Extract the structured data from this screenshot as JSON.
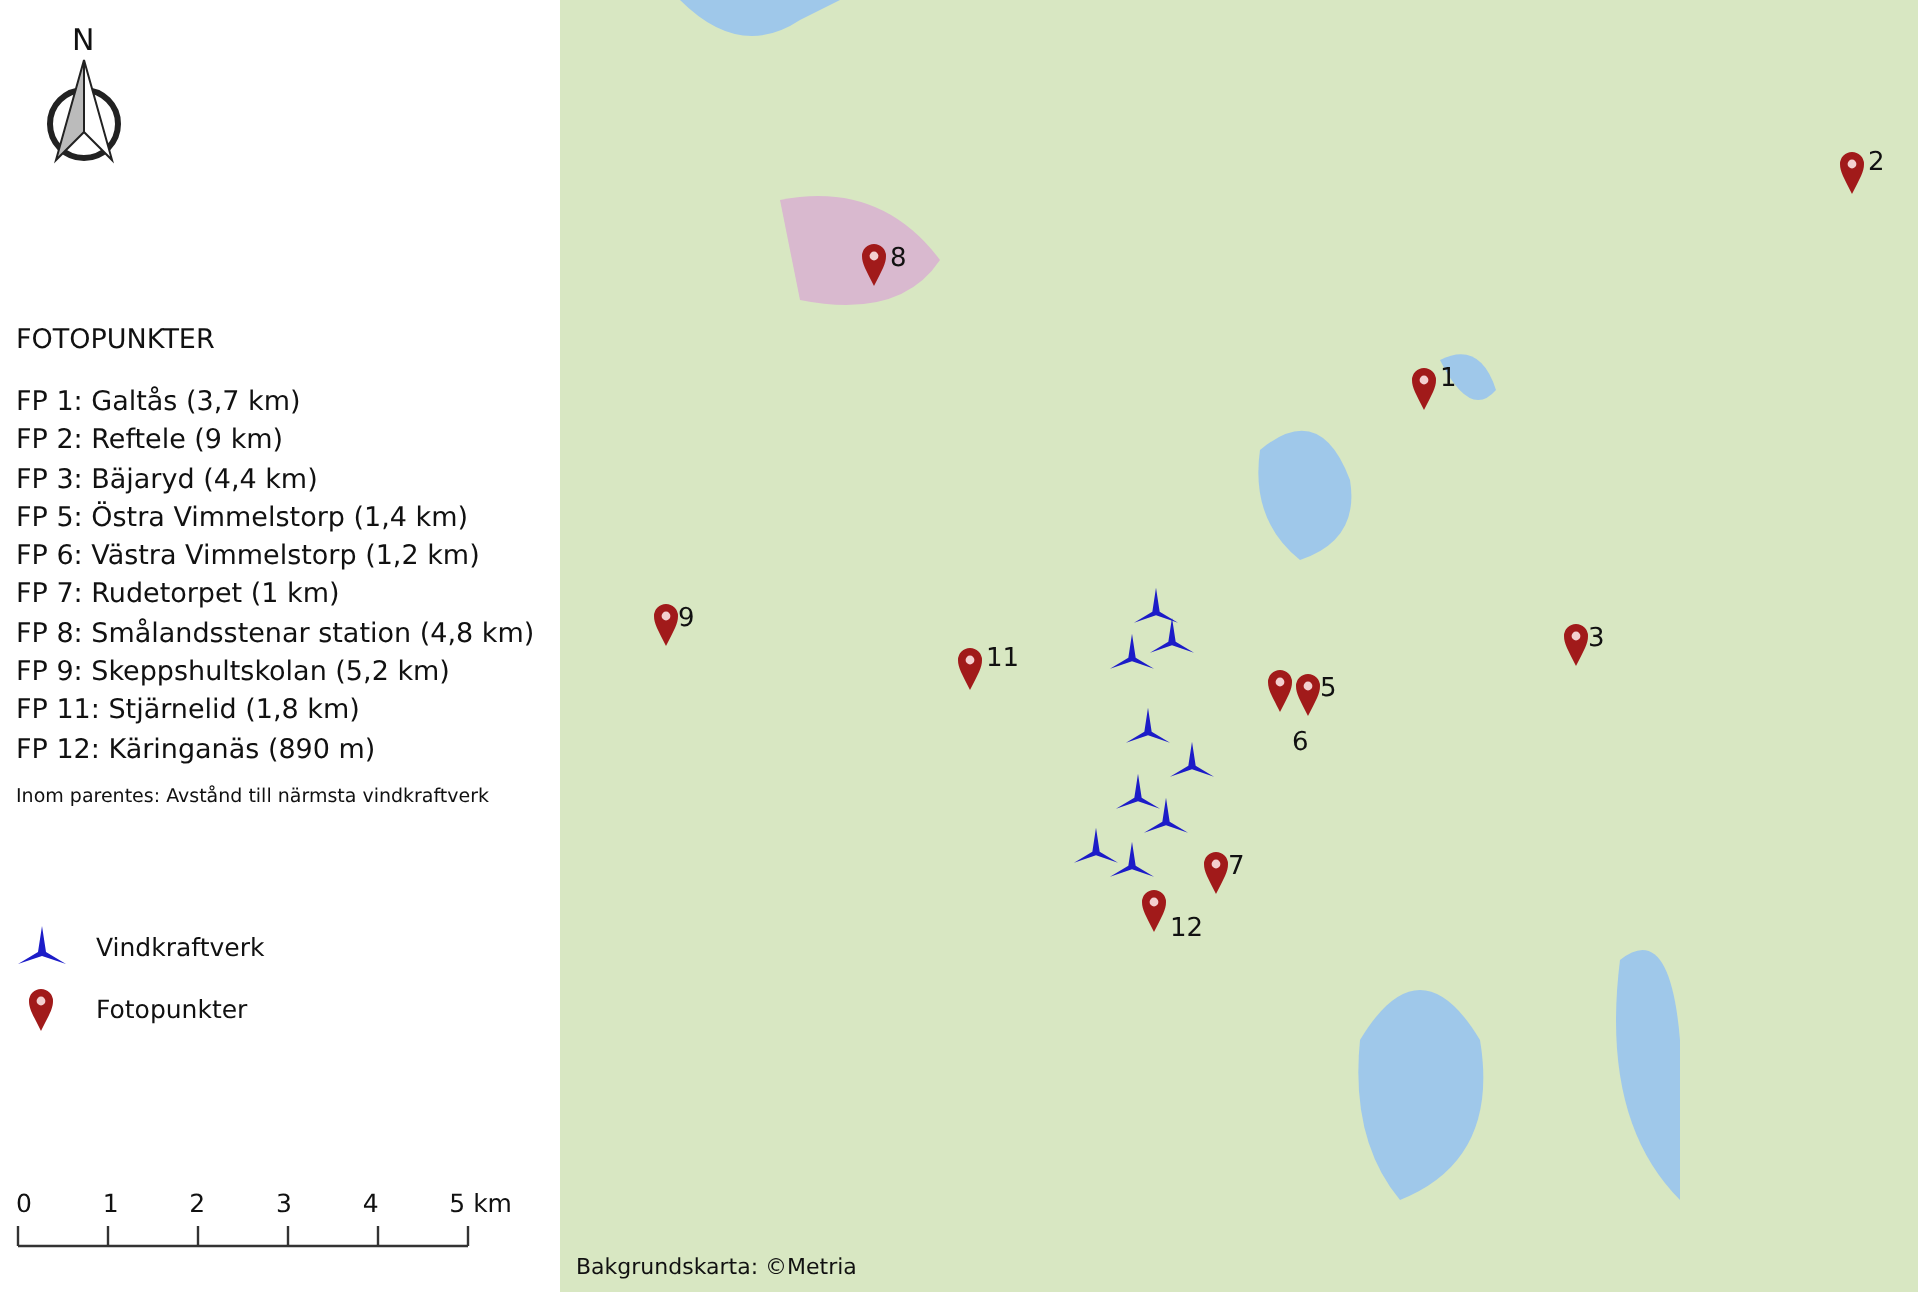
{
  "compass": {
    "label": "N"
  },
  "legend_title": "FOTOPUNKTER",
  "photo_points": [
    "FP 1: Galtås (3,7 km)",
    "FP 2: Reftele  (9 km)",
    "FP 3: Bäjaryd (4,4 km)",
    "FP 5: Östra Vimmelstorp (1,4 km)",
    "FP 6: Västra Vimmelstorp (1,2 km)",
    "FP 7: Rudetorpet (1 km)",
    "FP 8: Smålandsstenar station (4,8 km)",
    "FP 9: Skeppshultskolan (5,2 km)",
    "FP 11: Stjärnelid (1,8 km)",
    "FP 12: Käringanäs (890 m)"
  ],
  "note": "Inom parentes: Avstånd till närmsta vindkraftverk",
  "symbols": [
    {
      "kind": "turbine",
      "label": "Vindkraftverk"
    },
    {
      "kind": "pin",
      "label": "Fotopunkter"
    }
  ],
  "scale_bar": {
    "ticks": [
      "0",
      "1",
      "2",
      "3",
      "4",
      "5 km"
    ]
  },
  "map": {
    "pins": [
      {
        "number": "1"
      },
      {
        "number": "2"
      },
      {
        "number": "3"
      },
      {
        "number": "5"
      },
      {
        "number": "6"
      },
      {
        "number": "7"
      },
      {
        "number": "8"
      },
      {
        "number": "9"
      },
      {
        "number": "11"
      },
      {
        "number": "12"
      }
    ],
    "credit": "Bakgrundskarta: ©Metria"
  }
}
